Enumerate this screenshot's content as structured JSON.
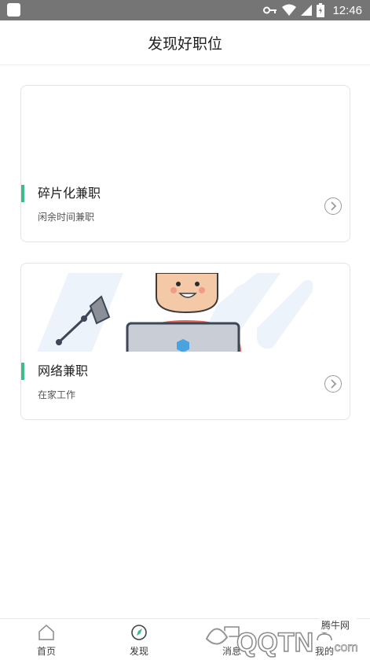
{
  "status_bar": {
    "time": "12:46"
  },
  "header": {
    "title": "发现好职位"
  },
  "cards": [
    {
      "title": "碎片化兼职",
      "subtitle": "闲余时间兼职"
    },
    {
      "title": "网络兼职",
      "subtitle": "在家工作"
    }
  ],
  "bottom_nav": {
    "items": [
      {
        "label": "首页",
        "icon": "home-icon"
      },
      {
        "label": "发现",
        "icon": "discover-compass-icon",
        "active": true
      },
      {
        "label": "消息",
        "icon": "message-icon"
      },
      {
        "label": "我的",
        "icon": "profile-icon"
      }
    ]
  },
  "watermark": {
    "text": "QQTN",
    "domain": ".com",
    "tag": "腾牛网"
  },
  "colors": {
    "accent": "#3dbd8c",
    "status_bar": "#757575"
  }
}
